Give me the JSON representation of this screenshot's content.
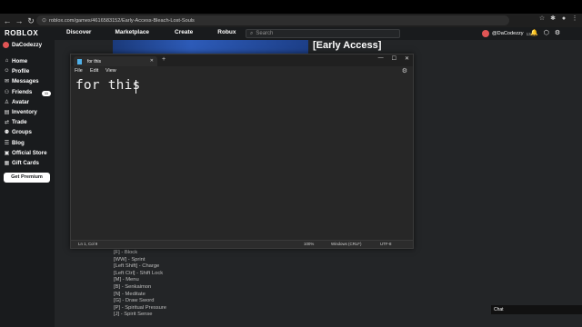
{
  "browser": {
    "url": "roblox.com/games/4616583152/Early-Access-Bleach-Lost-Souls"
  },
  "header": {
    "logo": "ROBLOX",
    "nav": [
      "Discover",
      "Marketplace",
      "Create",
      "Robux"
    ],
    "search_placeholder": "Search",
    "username": "@DaCodezzy",
    "age": "13+"
  },
  "sidebar": {
    "username": "DaCodezzy",
    "items": [
      {
        "label": "Home",
        "icon": "home-icon"
      },
      {
        "label": "Profile",
        "icon": "profile-icon"
      },
      {
        "label": "Messages",
        "icon": "messages-icon"
      },
      {
        "label": "Friends",
        "icon": "friends-icon"
      },
      {
        "label": "Avatar",
        "icon": "avatar-icon"
      },
      {
        "label": "Inventory",
        "icon": "inventory-icon"
      },
      {
        "label": "Trade",
        "icon": "trade-icon"
      },
      {
        "label": "Groups",
        "icon": "groups-icon"
      },
      {
        "label": "Blog",
        "icon": "blog-icon"
      },
      {
        "label": "Official Store",
        "icon": "store-icon"
      },
      {
        "label": "Gift Cards",
        "icon": "gift-cards-icon"
      }
    ],
    "friends_badge": "11",
    "premium_label": "Get Premium"
  },
  "game": {
    "title": "[Early Access]",
    "controls": [
      "[F] - Block",
      "[WW] - Sprint",
      "[Left Shift] - Charge",
      "[Left Ctrl] - Shift Lock",
      "[M] - Menu",
      "[B] - Senkaimon",
      "[N] - Meditate",
      "[G] - Draw Sword",
      "[P] - Spiritual Pressure",
      "[J] - Spirit Sense"
    ]
  },
  "chat": {
    "label": "Chat"
  },
  "notepad": {
    "tab_title": "for this",
    "menu": [
      "File",
      "Edit",
      "View"
    ],
    "content": "for this",
    "status": {
      "position": "Ln 1, Col 9",
      "zoom": "100%",
      "line_ending": "Windows (CRLF)",
      "encoding": "UTF-8"
    }
  }
}
